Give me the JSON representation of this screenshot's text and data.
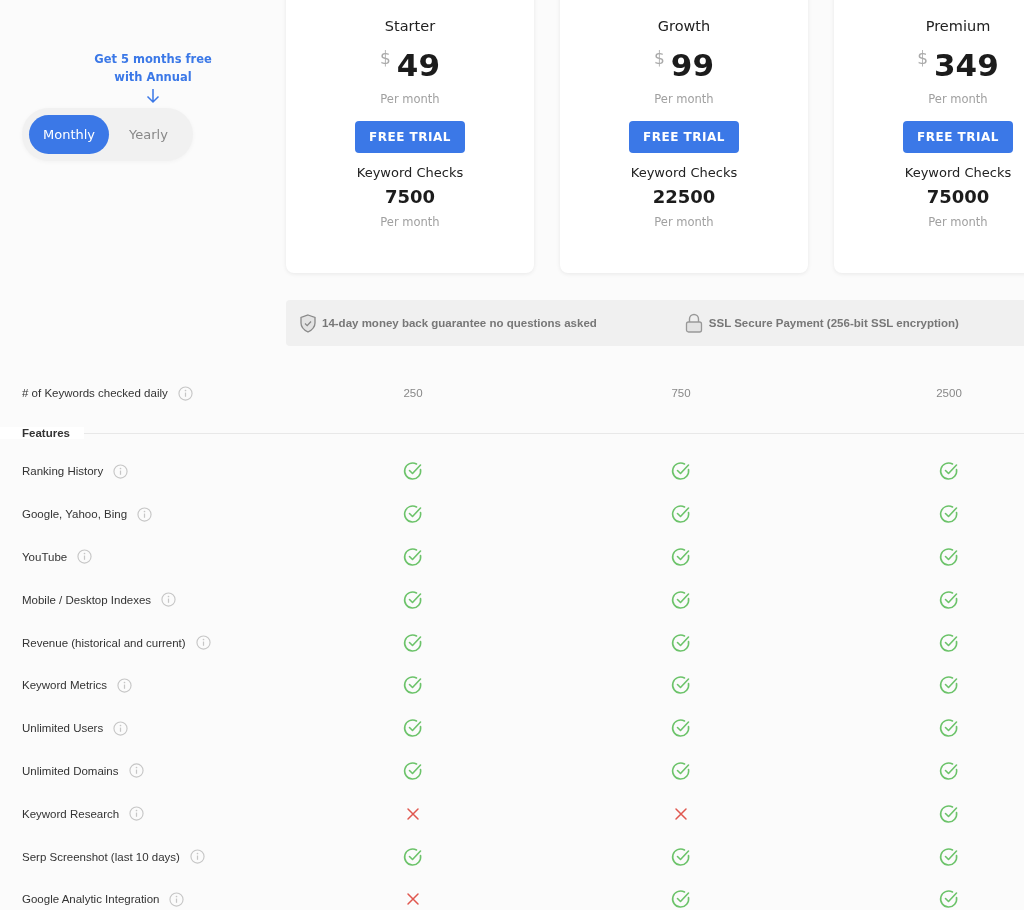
{
  "promo": {
    "text": "Get 5 months free with Annual"
  },
  "billing_toggle": [
    {
      "label": "Monthly",
      "selected": true
    },
    {
      "label": "Yearly",
      "selected": false
    }
  ],
  "plans": [
    {
      "name": "Starter",
      "currency": "$",
      "price": "49",
      "price_period": "Per month",
      "button": "FREE TRIAL",
      "checks_label": "Keyword Checks",
      "checks": "7500",
      "checks_period": "Per month"
    },
    {
      "name": "Growth",
      "currency": "$",
      "price": "99",
      "price_period": "Per month",
      "button": "FREE TRIAL",
      "checks_label": "Keyword Checks",
      "checks": "22500",
      "checks_period": "Per month"
    },
    {
      "name": "Premium",
      "currency": "$",
      "price": "349",
      "price_period": "Per month",
      "button": "FREE TRIAL",
      "checks_label": "Keyword Checks",
      "checks": "75000",
      "checks_period": "Per month"
    }
  ],
  "guarantees": [
    {
      "kind": "shield",
      "text": "14-day money back guarantee no questions asked"
    },
    {
      "kind": "lock",
      "text": "SSL Secure Payment (256-bit SSL encryption)"
    }
  ],
  "daily_keywords": {
    "label": "# of Keywords checked daily",
    "values": [
      "250",
      "750",
      "2500"
    ]
  },
  "features_heading": "Features",
  "features": [
    {
      "label": "Ranking History",
      "included": [
        true,
        true,
        true
      ]
    },
    {
      "label": "Google, Yahoo, Bing",
      "included": [
        true,
        true,
        true
      ]
    },
    {
      "label": "YouTube",
      "included": [
        true,
        true,
        true
      ]
    },
    {
      "label": "Mobile / Desktop Indexes",
      "included": [
        true,
        true,
        true
      ]
    },
    {
      "label": "Revenue (historical and current)",
      "included": [
        true,
        true,
        true
      ]
    },
    {
      "label": "Keyword Metrics",
      "included": [
        true,
        true,
        true
      ]
    },
    {
      "label": "Unlimited Users",
      "included": [
        true,
        true,
        true
      ]
    },
    {
      "label": "Unlimited Domains",
      "included": [
        true,
        true,
        true
      ]
    },
    {
      "label": "Keyword Research",
      "included": [
        false,
        false,
        true
      ]
    },
    {
      "label": "Serp Screenshot (last 10 days)",
      "included": [
        true,
        true,
        true
      ]
    },
    {
      "label": "Google Analytic Integration",
      "included": [
        false,
        true,
        true
      ]
    }
  ]
}
